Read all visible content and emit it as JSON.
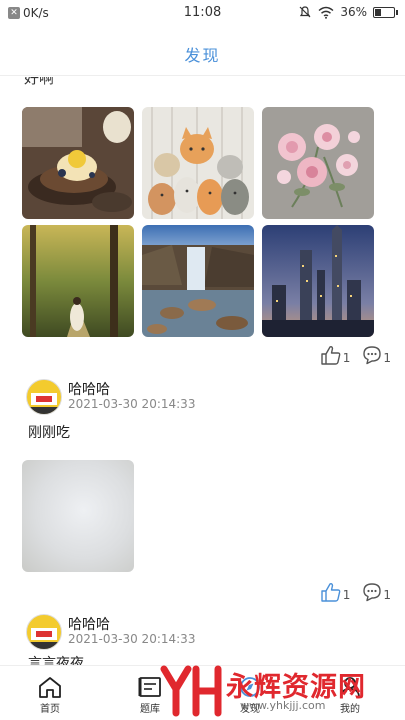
{
  "status_bar": {
    "network_speed": "0K/s",
    "time": "11:08",
    "battery_percent": "36%",
    "battery_level": 0.36
  },
  "header": {
    "title": "发现"
  },
  "feed": {
    "first_post": {
      "text_fragment": "好啊",
      "photo_count": 6,
      "likes": "1",
      "comments": "1"
    },
    "posts": [
      {
        "username": "哈哈哈",
        "timestamp": "2021-03-30 20:14:33",
        "text": "刚刚吃",
        "likes": "1",
        "comments": "1"
      },
      {
        "username": "哈哈哈",
        "timestamp": "2021-03-30 20:14:33",
        "text": "言言夜夜"
      }
    ]
  },
  "bottom_nav": {
    "tabs": [
      {
        "label": "首页",
        "icon": "home-icon"
      },
      {
        "label": "题库",
        "icon": "question-bank-icon"
      },
      {
        "label": "发现",
        "icon": "discover-icon"
      },
      {
        "label": "我的",
        "icon": "profile-icon"
      }
    ]
  },
  "watermark": {
    "logo_text": "YH",
    "title": "永辉资源网",
    "url": "www.yhkjjj.com"
  },
  "colors": {
    "accent": "#4a90d9",
    "watermark_red": "#e0282e"
  }
}
